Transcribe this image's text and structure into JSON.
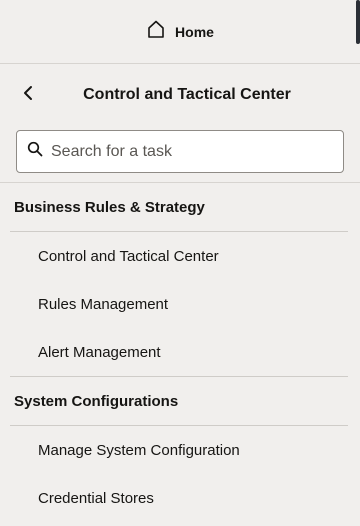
{
  "header": {
    "home_label": "Home",
    "home_icon": "home-icon"
  },
  "page": {
    "title": "Control and Tactical Center",
    "back_icon": "chevron-left-icon"
  },
  "search": {
    "placeholder": "Search for a task",
    "value": "",
    "icon": "search-icon"
  },
  "sections": [
    {
      "title": "Business Rules & Strategy",
      "items": [
        "Control and Tactical Center",
        "Rules Management",
        "Alert Management"
      ]
    },
    {
      "title": "System Configurations",
      "items": [
        "Manage System Configuration",
        "Credential Stores"
      ]
    }
  ]
}
